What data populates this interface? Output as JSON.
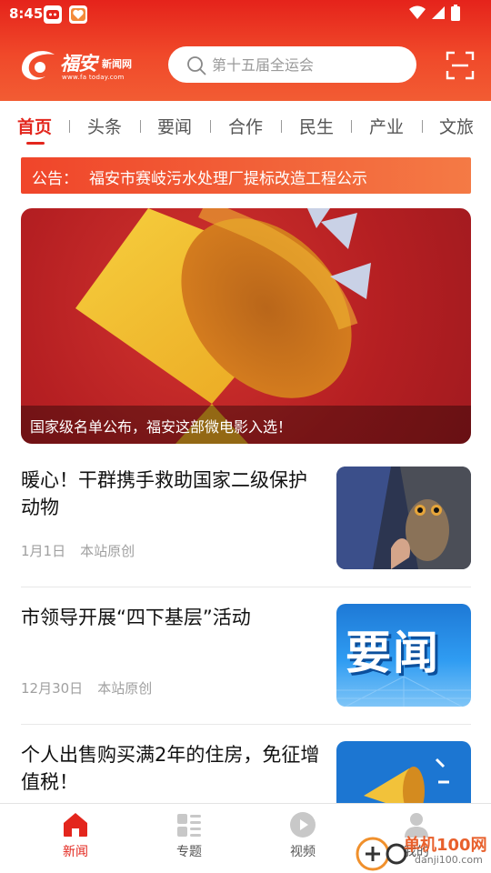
{
  "status_bar": {
    "time": "8:45"
  },
  "header": {
    "logo": {
      "brand_text": "福安",
      "sub_text": "新闻网",
      "url_text": "www.fa today.com"
    },
    "search": {
      "placeholder": "第十五届全运会"
    }
  },
  "tabs": [
    {
      "label": "首页",
      "active": true
    },
    {
      "label": "头条"
    },
    {
      "label": "要闻"
    },
    {
      "label": "合作"
    },
    {
      "label": "民生"
    },
    {
      "label": "产业"
    },
    {
      "label": "文旅"
    }
  ],
  "notice": {
    "label": "公告：",
    "text": "福安市赛岐污水处理厂提标改造工程公示"
  },
  "banner": {
    "caption": "国家级名单公布，福安这部微电影入选！"
  },
  "news": [
    {
      "title": "暖心！干群携手救助国家二级保护动物",
      "date": "1月1日",
      "source": "本站原创"
    },
    {
      "title": "市领导开展“四下基层”活动",
      "date": "12月30日",
      "source": "本站原创",
      "thumb_text": "要闻"
    },
    {
      "title": "个人出售购买满2年的住房，免征增值税！"
    }
  ],
  "bottom_nav": [
    {
      "label": "新闻",
      "icon": "home-icon",
      "active": true
    },
    {
      "label": "专题",
      "icon": "topics-icon"
    },
    {
      "label": "视频",
      "icon": "video-play-icon"
    },
    {
      "label": "我的",
      "icon": "user-icon"
    }
  ],
  "watermark": {
    "text": "单机100网",
    "url": "danji100.com"
  },
  "colors": {
    "accent": "#e3261d",
    "header_top": "#e5231b",
    "header_bottom": "#f25c33"
  }
}
